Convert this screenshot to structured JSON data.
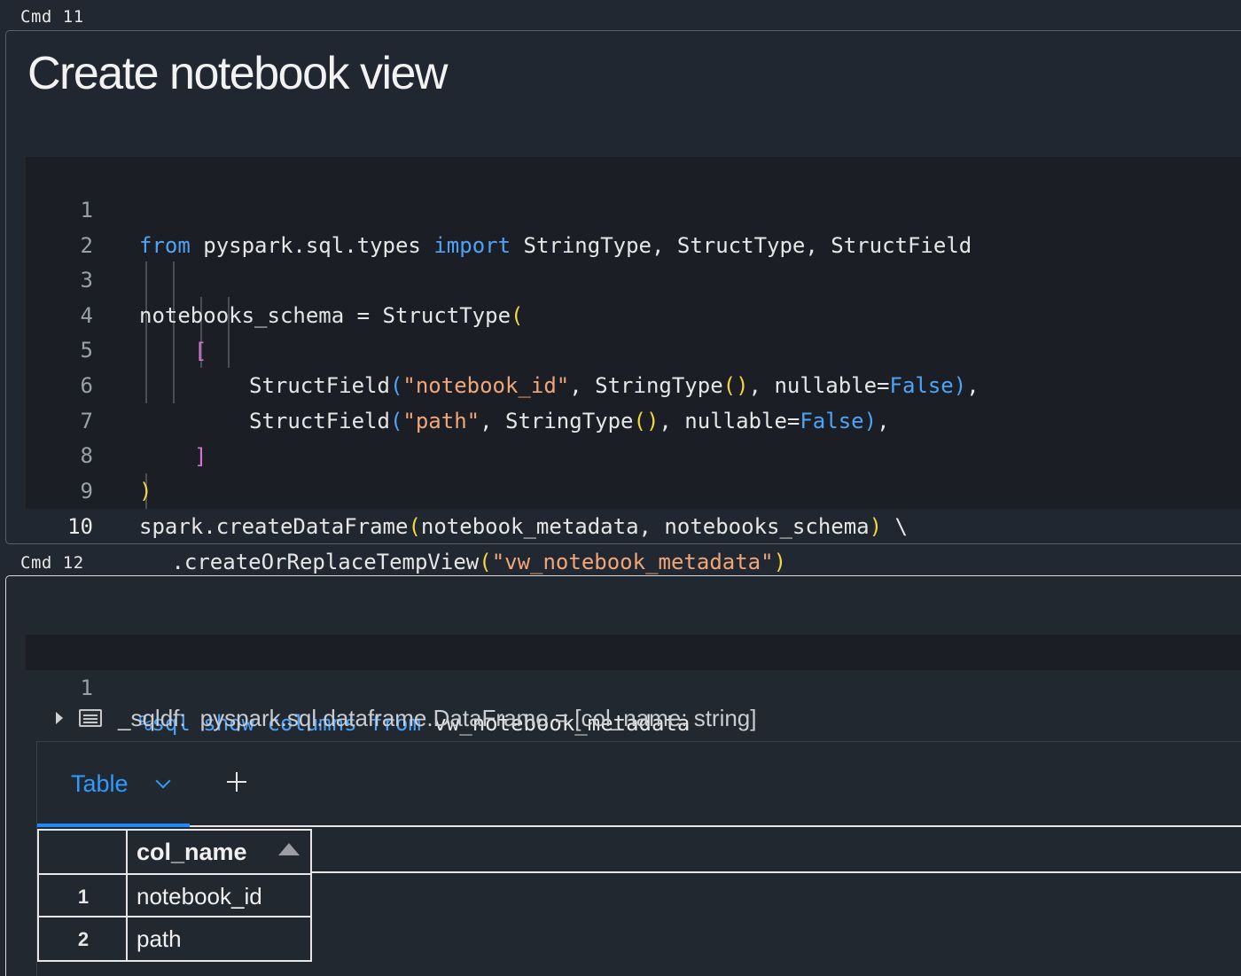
{
  "cells": [
    {
      "label": "Cmd 11",
      "title": "Create notebook view",
      "code_lines": [
        {
          "num": "1"
        },
        {
          "num": "2"
        },
        {
          "num": "3"
        },
        {
          "num": "4"
        },
        {
          "num": "5"
        },
        {
          "num": "6"
        },
        {
          "num": "7"
        },
        {
          "num": "8"
        },
        {
          "num": "9"
        },
        {
          "num": "10"
        }
      ],
      "tokens": {
        "l1_from": "from",
        "l1_mod": " pyspark.sql.types ",
        "l1_import": "import",
        "l1_rest": " StringType, StructType, StructField",
        "l3_a": "notebooks_schema = StructType",
        "l3_paren": "(",
        "l4_br": "[",
        "l5_a": "StructField",
        "l5_p1": "(",
        "l5_s": "\"notebook_id\"",
        "l5_b": ", StringType",
        "l5_p2": "()",
        "l5_c": ", nullable=",
        "l5_f": "False",
        "l5_p3": ")",
        "l5_d": ",",
        "l6_a": "StructField",
        "l6_p1": "(",
        "l6_s": "\"path\"",
        "l6_b": ", StringType",
        "l6_p2": "()",
        "l6_c": ", nullable=",
        "l6_f": "False",
        "l6_p3": ")",
        "l6_d": ",",
        "l7_br": "]",
        "l8_paren": ")",
        "l9_a": "spark.createDataFrame",
        "l9_p1": "(",
        "l9_b": "notebook_metadata, notebooks_schema",
        "l9_p2": ")",
        "l9_c": " \\",
        "l10_a": " .createOrReplaceTempView",
        "l10_p1": "(",
        "l10_s": "\"vw_notebook_metadata\"",
        "l10_p2": ")"
      }
    },
    {
      "label": "Cmd 12",
      "code_lines": [
        {
          "num": "1"
        }
      ],
      "tokens": {
        "sql": "%sql",
        "show": "show",
        "columns": "columns",
        "from": "from",
        "tbl": " vw_notebook_metadata"
      },
      "result": {
        "df_name": "_sqldf:",
        "df_type": "pyspark.sql.dataframe.DataFrame = [col_name: string]",
        "tab_label": "Table",
        "column_header": "col_name",
        "rows": [
          {
            "num": "1",
            "value": "notebook_id"
          },
          {
            "num": "2",
            "value": "path"
          }
        ]
      }
    }
  ],
  "colors": {
    "keyword": "#4fa3f7",
    "string": "#f0a678",
    "bracket_level1": "#f5d540",
    "bracket_level2": "#d66fd8",
    "active_tab": "#2e9bff"
  },
  "icons": [
    "caret-right-icon",
    "dataframe-icon",
    "chevron-down-icon",
    "plus-icon",
    "sort-asc-icon"
  ]
}
